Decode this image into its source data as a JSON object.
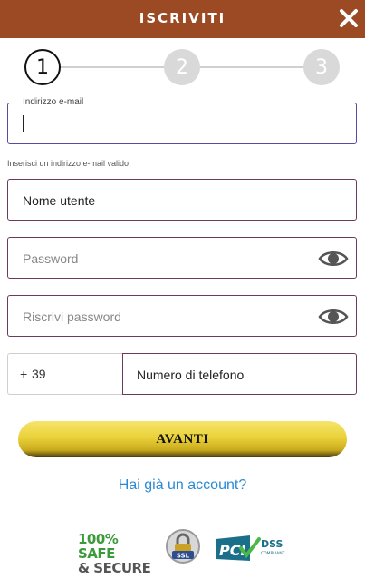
{
  "header": {
    "title": "ISCRIVITI",
    "close_icon": "close-icon"
  },
  "stepper": {
    "steps": [
      "1",
      "2",
      "3"
    ],
    "current": 1
  },
  "email": {
    "label": "Indirizzo e-mail",
    "value": "",
    "hint": "Inserisci un indirizzo e-mail valido"
  },
  "username": {
    "value": "Nome utente"
  },
  "password": {
    "placeholder": "Password",
    "icon": "eye-icon"
  },
  "confirm_password": {
    "placeholder": "Riscrivi password",
    "icon": "eye-icon"
  },
  "phone": {
    "plus": "+",
    "code": "39",
    "value": "Numero di telefono"
  },
  "next_button": {
    "label": "AVANTI"
  },
  "account_link": {
    "label": "Hai già un account?"
  },
  "badges": {
    "safe_line1": "100% SAFE",
    "safe_line2": "& SECURE",
    "ssl_text": "SSL",
    "pci_text": "PCI",
    "dss_text": "DSS",
    "compliant_text": "COMPLIANT"
  },
  "colors": {
    "header": "#9b4a23",
    "accent_border": "#6b3a5e",
    "link": "#2a8ad4",
    "button": "#ead23a"
  }
}
